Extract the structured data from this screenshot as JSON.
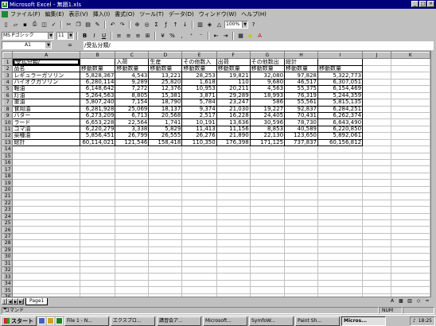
{
  "window": {
    "title": "Microsoft Excel - 無題1.xls"
  },
  "menu": [
    "ファイル(F)",
    "編集(E)",
    "表示(V)",
    "挿入(I)",
    "書式(O)",
    "ツール(T)",
    "データ(D)",
    "ウィンドウ(W)",
    "ヘルプ(H)"
  ],
  "toolbar": {
    "zoom": "100%",
    "font": "MS Pゴシック",
    "size": "11"
  },
  "formula_bar": {
    "cell_ref": "A1",
    "fx": "=",
    "value": "/受払分類/"
  },
  "columns": [
    "",
    "A",
    "B",
    "C",
    "D",
    "E",
    "F",
    "G",
    "H",
    "I",
    "J",
    "K"
  ],
  "rows": [
    [
      "/受払分類/",
      "",
      "入荷",
      "生産",
      "その他数入",
      "出荷",
      "その他数出",
      "総計",
      "",
      "",
      ""
    ],
    [
      "品名",
      "移動数量",
      "移動数量",
      "移動数量",
      "移動数量",
      "移動数量",
      "移動数量",
      "移動数量",
      "移動数量",
      "",
      ""
    ],
    [
      "レギュラーガソリン",
      "5,828,367",
      "4,543",
      "13,221",
      "28,253",
      "19,821",
      "32,080",
      "97,828",
      "5,322,773",
      "",
      ""
    ],
    [
      "ハイオクガソリン",
      "6,280,114",
      "9,289",
      "25,820",
      "1,618",
      "110",
      "9,680",
      "46,517",
      "6,307,051",
      "",
      ""
    ],
    [
      "軽油",
      "6,148,642",
      "7,272",
      "12,376",
      "10,953",
      "20,211",
      "4,563",
      "55,375",
      "6,154,469",
      "",
      ""
    ],
    [
      "灯油",
      "5,264,563",
      "8,805",
      "15,381",
      "3,871",
      "29,289",
      "18,993",
      "76,319",
      "5,244,359",
      "",
      ""
    ],
    [
      "重油",
      "5,807,240",
      "7,154",
      "18,790",
      "5,784",
      "23,247",
      "586",
      "55,561",
      "5,815,135",
      "",
      ""
    ],
    [
      "食用油",
      "6,281,928",
      "25,069",
      "18,137",
      "9,374",
      "21,030",
      "19,227",
      "92,837",
      "6,284,251",
      "",
      ""
    ],
    [
      "バター",
      "6,273,209",
      "6,713",
      "20,568",
      "2,517",
      "16,228",
      "24,405",
      "70,431",
      "6,262,374",
      "",
      ""
    ],
    [
      "ラード",
      "6,653,228",
      "22,564",
      "1,741",
      "10,191",
      "13,636",
      "30,596",
      "78,730",
      "6,643,490",
      "",
      ""
    ],
    [
      "ゴマ油",
      "6,220,279",
      "3,338",
      "5,829",
      "11,413",
      "11,156",
      "8,853",
      "40,589",
      "6,220,850",
      "",
      ""
    ],
    [
      "菜種油",
      "5,856,451",
      "26,799",
      "26,555",
      "26,276",
      "21,890",
      "22,130",
      "123,650",
      "5,892,061",
      "",
      ""
    ],
    [
      "総計",
      "60,114,021",
      "121,546",
      "158,418",
      "110,350",
      "176,398",
      "171,125",
      "737,837",
      "60,156,812",
      "",
      ""
    ]
  ],
  "total_rows": 36,
  "sheet_tab": "Page1",
  "status": {
    "left": "コマンド",
    "num": "NUM"
  },
  "taskbar": {
    "start": "スタート",
    "tasks": [
      "File 1 - N...",
      "エクスプロ...",
      "講習会ア...",
      "Microsoft...",
      "SymfoW...",
      "Paint Sh...",
      "Micros..."
    ],
    "clock": "18:25"
  }
}
